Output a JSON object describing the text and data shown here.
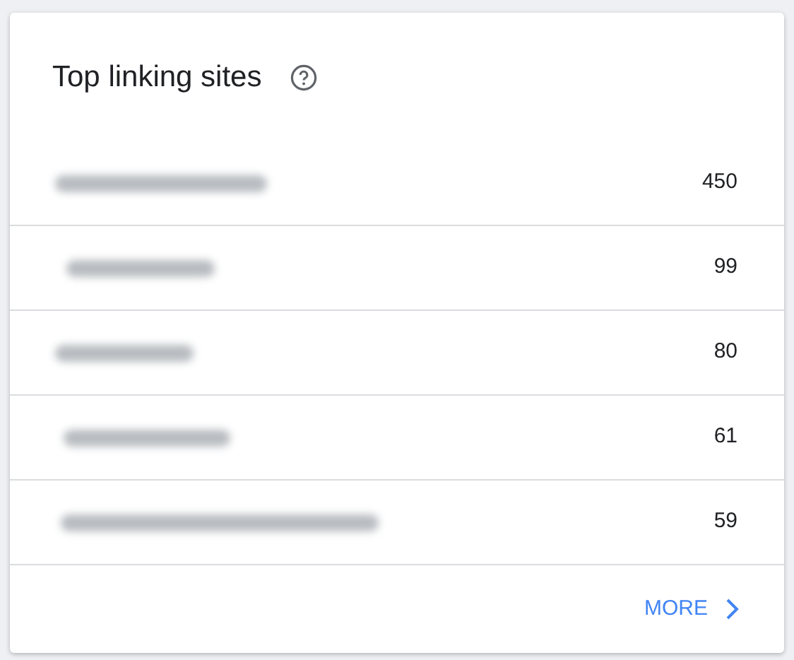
{
  "card": {
    "title": "Top linking sites",
    "help_icon": true
  },
  "rows": [
    {
      "site_blurred": true,
      "count": "450"
    },
    {
      "site_blurred": true,
      "count": "99"
    },
    {
      "site_blurred": true,
      "count": "80"
    },
    {
      "site_blurred": true,
      "count": "61"
    },
    {
      "site_blurred": true,
      "count": "59"
    }
  ],
  "more_button": {
    "label": "MORE"
  }
}
